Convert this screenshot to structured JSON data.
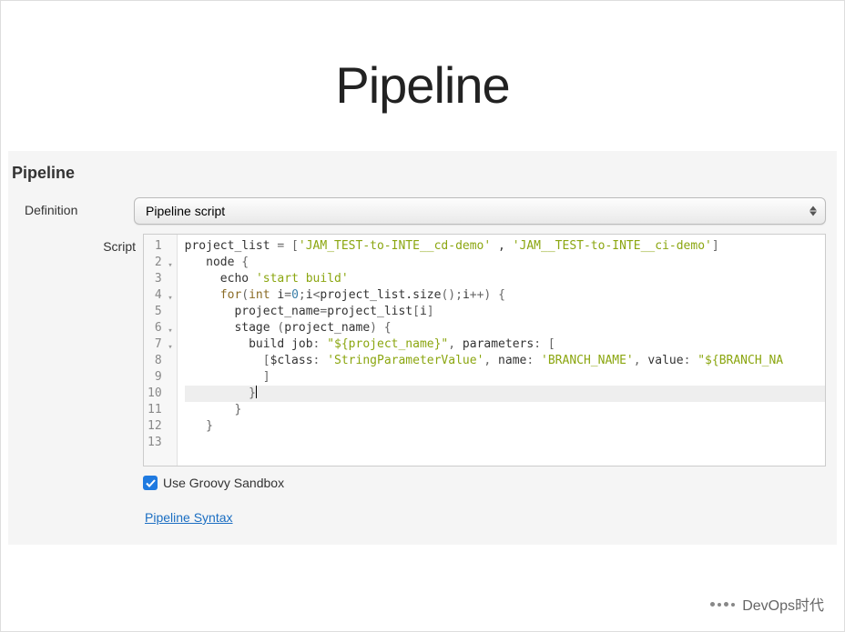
{
  "slide": {
    "title": "Pipeline"
  },
  "section": {
    "header": "Pipeline"
  },
  "labels": {
    "definition": "Definition",
    "script": "Script",
    "sandbox": "Use Groovy Sandbox",
    "syntax_link": "Pipeline Syntax"
  },
  "definition_select": {
    "value": "Pipeline script"
  },
  "code": {
    "lines": [
      {
        "n": 1,
        "fold": false,
        "tokens": [
          [
            "id",
            "project_list "
          ],
          [
            "op",
            "= ["
          ],
          [
            "str",
            "'JAM_TEST-to-INTE__cd-demo'"
          ],
          [
            "id",
            " , "
          ],
          [
            "str",
            "'JAM__TEST-to-INTE__ci-demo'"
          ],
          [
            "op",
            "]"
          ]
        ]
      },
      {
        "n": 2,
        "fold": true,
        "tokens": [
          [
            "id",
            "   node "
          ],
          [
            "op",
            "{"
          ]
        ]
      },
      {
        "n": 3,
        "fold": false,
        "tokens": [
          [
            "id",
            "     echo "
          ],
          [
            "str",
            "'start build'"
          ]
        ]
      },
      {
        "n": 4,
        "fold": true,
        "tokens": [
          [
            "id",
            "     "
          ],
          [
            "key",
            "for"
          ],
          [
            "op",
            "("
          ],
          [
            "key",
            "int"
          ],
          [
            "id",
            " i"
          ],
          [
            "op",
            "="
          ],
          [
            "num",
            "0"
          ],
          [
            "op",
            ";"
          ],
          [
            "id",
            "i"
          ],
          [
            "op",
            "<"
          ],
          [
            "id",
            "project_list.size"
          ],
          [
            "op",
            "();"
          ],
          [
            "id",
            "i"
          ],
          [
            "op",
            "++) {"
          ]
        ]
      },
      {
        "n": 5,
        "fold": false,
        "tokens": [
          [
            "id",
            "       project_name"
          ],
          [
            "op",
            "="
          ],
          [
            "id",
            "project_list"
          ],
          [
            "op",
            "["
          ],
          [
            "id",
            "i"
          ],
          [
            "op",
            "]"
          ]
        ]
      },
      {
        "n": 6,
        "fold": true,
        "tokens": [
          [
            "id",
            "       stage "
          ],
          [
            "op",
            "("
          ],
          [
            "id",
            "project_name"
          ],
          [
            "op",
            ") {"
          ]
        ]
      },
      {
        "n": 7,
        "fold": true,
        "tokens": [
          [
            "id",
            "         build job"
          ],
          [
            "op",
            ": "
          ],
          [
            "str",
            "\"${project_name}\""
          ],
          [
            "op",
            ", "
          ],
          [
            "id",
            "parameters"
          ],
          [
            "op",
            ": ["
          ]
        ]
      },
      {
        "n": 8,
        "fold": false,
        "tokens": [
          [
            "id",
            "           "
          ],
          [
            "op",
            "["
          ],
          [
            "id",
            "$class"
          ],
          [
            "op",
            ": "
          ],
          [
            "str",
            "'StringParameterValue'"
          ],
          [
            "op",
            ", "
          ],
          [
            "id",
            "name"
          ],
          [
            "op",
            ": "
          ],
          [
            "str",
            "'BRANCH_NAME'"
          ],
          [
            "op",
            ", "
          ],
          [
            "id",
            "value"
          ],
          [
            "op",
            ": "
          ],
          [
            "str",
            "\"${BRANCH_NA"
          ]
        ]
      },
      {
        "n": 9,
        "fold": false,
        "tokens": [
          [
            "id",
            "           "
          ],
          [
            "op",
            "]"
          ]
        ]
      },
      {
        "n": 10,
        "fold": false,
        "active": true,
        "tokens": [
          [
            "id",
            "         "
          ],
          [
            "op",
            "}"
          ],
          [
            "cursor",
            ""
          ]
        ]
      },
      {
        "n": 11,
        "fold": false,
        "tokens": [
          [
            "id",
            "       "
          ],
          [
            "op",
            "}"
          ]
        ]
      },
      {
        "n": 12,
        "fold": false,
        "tokens": [
          [
            "id",
            "   "
          ],
          [
            "op",
            "}"
          ]
        ]
      },
      {
        "n": 13,
        "fold": false,
        "tokens": []
      }
    ]
  },
  "sandbox": {
    "checked": true
  },
  "watermark": {
    "text": "DevOps时代"
  }
}
